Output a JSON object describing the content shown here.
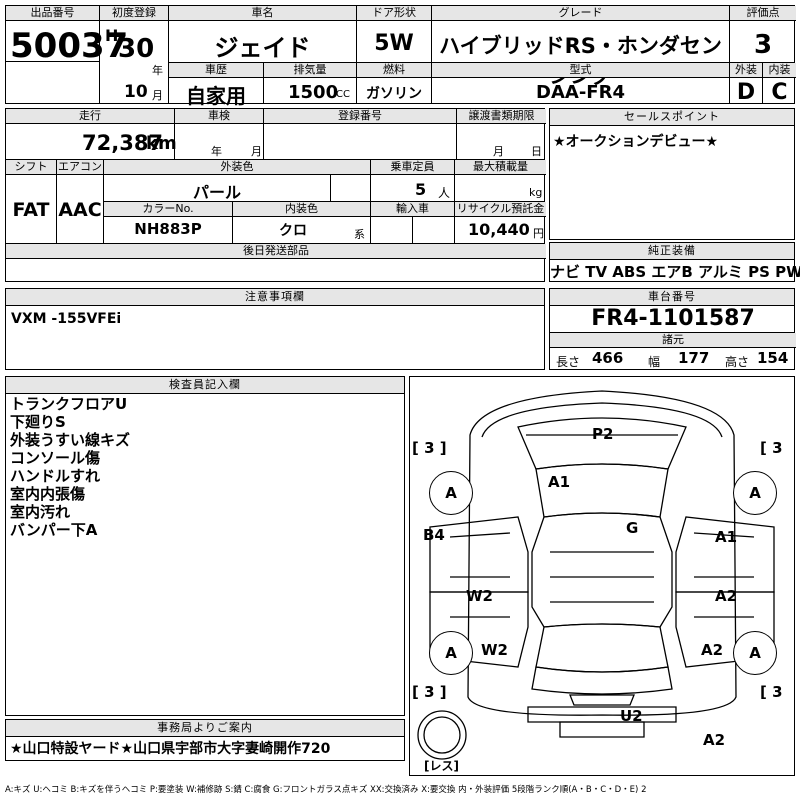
{
  "header": {
    "lot_label": "出品番号",
    "lot_no": "50037",
    "first_reg_label": "初度登録",
    "era": "H",
    "year": "30",
    "year_unit": "年",
    "month": "10",
    "month_unit": "月",
    "car_name_label": "車名",
    "car_name": "ジェイド",
    "history_label": "車歴",
    "history": "自家用",
    "displacement_label": "排気量",
    "displacement": "1500",
    "cc": "CC",
    "door_label": "ドア形状",
    "door": "5W",
    "fuel_label": "燃料",
    "fuel": "ガソリン",
    "grade_label": "グレード",
    "grade": "ハイブリッドRS・ホンダセンシング",
    "model_label": "型式",
    "model": "DAA-FR4",
    "score_label": "評価点",
    "score": "3",
    "ext_label": "外装",
    "ext": "D",
    "int_label": "内装",
    "int": "C"
  },
  "mid": {
    "mileage_label": "走行",
    "mileage": "72,387",
    "km": "km",
    "inspection_label": "車検",
    "insp_year_unit": "年",
    "insp_month_unit": "月",
    "reg_no_label": "登録番号",
    "transfer_label": "譲渡書類期限",
    "transfer_month_unit": "月",
    "transfer_day_unit": "日",
    "shift_label": "シフト",
    "shift": "FAT",
    "ac_label": "エアコン",
    "ac": "AAC",
    "color_label": "外装色",
    "color": "パール",
    "color_no_label": "カラーNo.",
    "color_no": "NH883P",
    "int_color_label": "内装色",
    "int_color": "クロ",
    "int_color_unit": "系",
    "capacity_label": "乗車定員",
    "capacity": "5",
    "capacity_unit": "人",
    "load_label": "最大積載量",
    "load_unit": "kg",
    "import_label": "輸入車",
    "recycle_label": "リサイクル預託金",
    "recycle": "10,440",
    "recycle_unit": "円",
    "parts_label": "後日発送部品"
  },
  "sales": {
    "label": "セールスポイント",
    "text": "★オークションデビュー★"
  },
  "equipment": {
    "label": "純正装備",
    "items": "ナビ TV ABS エアB アルミ PS PW"
  },
  "caution": {
    "label": "注意事項欄",
    "text": "VXM -155VFEi"
  },
  "chassis": {
    "label": "車台番号",
    "number": "FR4-1101587",
    "spec_label": "諸元",
    "len_label": "長さ",
    "len": "466",
    "wid_label": "幅",
    "wid": "177",
    "hgt_label": "高さ",
    "hgt": "154"
  },
  "inspector": {
    "label": "検査員記入欄",
    "lines": [
      "トランクフロアU",
      "下廻りS",
      "外装うすい線キズ",
      "コンソール傷",
      "ハンドルすれ",
      "室内内張傷",
      "室内汚れ",
      "バンパー下A"
    ]
  },
  "diagram": {
    "marks": {
      "p2": "P2",
      "a1_hood": "A1",
      "g": "G",
      "b4": "B4",
      "a1_right": "A1",
      "w2_left": "W2",
      "a2_right": "A2",
      "w2_rear_left": "W2",
      "a2_rear_right": "A2",
      "u2": "U2",
      "a2_bottom": "A2"
    },
    "tire_grade": "A",
    "bracket_val": "3",
    "spare_label": "レス"
  },
  "office": {
    "label": "事務局よりご案内",
    "text": "★山口特設ヤード★山口県宇部市大字妻崎開作720"
  },
  "legend": {
    "text": "A:キズ U:ヘコミ B:キズを伴うヘコミ P:要塗装 W:補修跡 S:錆 C:腐食 G:フロントガラス点キズ XX:交換済み X:要交換 内・外装評価 5段階ランク順(A・B・C・D・E) 2"
  }
}
